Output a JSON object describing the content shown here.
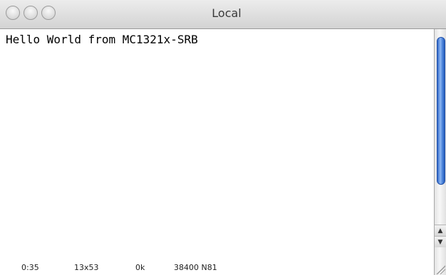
{
  "window": {
    "title": "Local"
  },
  "terminal": {
    "lines": [
      "Hello World from MC1321x-SRB"
    ]
  },
  "statusbar": {
    "time": "0:35",
    "dimensions": "13x53",
    "transfer": "0k",
    "settings": "38400 N81"
  },
  "icons": {
    "close": "close-icon",
    "minimize": "minimize-icon",
    "zoom": "zoom-icon",
    "scroll_up": "arrow-up-icon",
    "scroll_down": "arrow-down-icon",
    "resize": "resize-grip-icon"
  },
  "colors": {
    "scroll_thumb": "#3b73d1",
    "titlebar": "#dcdcdc",
    "text": "#000000"
  }
}
